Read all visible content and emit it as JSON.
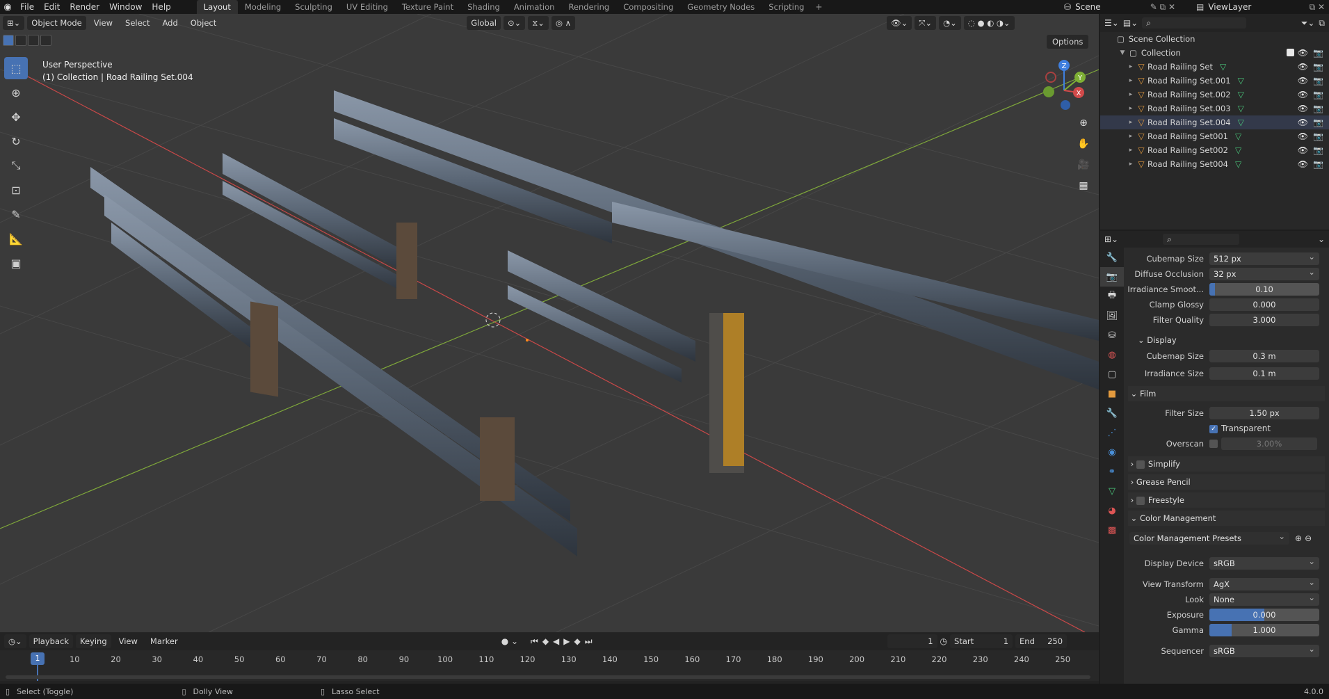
{
  "topbar": {
    "menus": [
      "File",
      "Edit",
      "Render",
      "Window",
      "Help"
    ],
    "workspaces": [
      {
        "label": "Layout",
        "active": true
      },
      {
        "label": "Modeling"
      },
      {
        "label": "Sculpting"
      },
      {
        "label": "UV Editing"
      },
      {
        "label": "Texture Paint"
      },
      {
        "label": "Shading"
      },
      {
        "label": "Animation"
      },
      {
        "label": "Rendering"
      },
      {
        "label": "Compositing"
      },
      {
        "label": "Geometry Nodes"
      },
      {
        "label": "Scripting"
      }
    ],
    "plus": "+",
    "scene": "Scene",
    "view_layer": "ViewLayer"
  },
  "viewport": {
    "mode": "Object Mode",
    "menus": [
      "View",
      "Select",
      "Add",
      "Object"
    ],
    "orientation": "Global",
    "options": "Options",
    "perspective": "User Perspective",
    "active_info": "(1) Collection | Road Railing Set.004",
    "gizmo_axes": {
      "z": "Z",
      "y": "Y",
      "x": "X"
    }
  },
  "outliner": {
    "scene_collection": "Scene Collection",
    "collection": "Collection",
    "objects": [
      "Road Railing Set",
      "Road Railing Set.001",
      "Road Railing Set.002",
      "Road Railing Set.003",
      "Road Railing Set.004",
      "Road Railing Set001",
      "Road Railing Set002",
      "Road Railing Set004"
    ],
    "selected_index": 4
  },
  "properties": {
    "cubemap_size": {
      "label": "Cubemap Size",
      "value": "512 px"
    },
    "diffuse_occlusion": {
      "label": "Diffuse Occlusion",
      "value": "32 px"
    },
    "irradiance_smooth": {
      "label": "Irradiance Smoot...",
      "value": "0.10",
      "fill": 0.05
    },
    "clamp_glossy": {
      "label": "Clamp Glossy",
      "value": "0.000"
    },
    "filter_quality": {
      "label": "Filter Quality",
      "value": "3.000"
    },
    "display_section": "Display",
    "display_cubemap": {
      "label": "Cubemap Size",
      "value": "0.3 m"
    },
    "irradiance_size": {
      "label": "Irradiance Size",
      "value": "0.1 m"
    },
    "film_section": "Film",
    "filter_size": {
      "label": "Filter Size",
      "value": "1.50 px"
    },
    "transparent": "Transparent",
    "overscan": {
      "label": "Overscan",
      "value": "3.00%"
    },
    "simplify": "Simplify",
    "grease_pencil": "Grease Pencil",
    "freestyle": "Freestyle",
    "color_management": "Color Management",
    "cm_presets": "Color Management Presets",
    "display_device": {
      "label": "Display Device",
      "value": "sRGB"
    },
    "view_transform": {
      "label": "View Transform",
      "value": "AgX"
    },
    "look": {
      "label": "Look",
      "value": "None"
    },
    "exposure": {
      "label": "Exposure",
      "value": "0.000",
      "fill": 0.5
    },
    "gamma": {
      "label": "Gamma",
      "value": "1.000",
      "fill": 0.2
    },
    "sequencer": {
      "label": "Sequencer",
      "value": "sRGB"
    }
  },
  "timeline": {
    "menus": [
      "Playback",
      "Keying",
      "View",
      "Marker"
    ],
    "current_frame": "1",
    "start_label": "Start",
    "start": "1",
    "end_label": "End",
    "end": "250",
    "playhead": "1",
    "ticks": [
      "10",
      "20",
      "30",
      "40",
      "50",
      "60",
      "70",
      "80",
      "90",
      "100",
      "110",
      "120",
      "130",
      "140",
      "150",
      "160",
      "170",
      "180",
      "190",
      "200",
      "210",
      "220",
      "230",
      "240",
      "250"
    ]
  },
  "status": {
    "select": "Select (Toggle)",
    "dolly": "Dolly View",
    "lasso": "Lasso Select",
    "version": "4.0.0"
  },
  "colors": {
    "accent": "#4772b3",
    "object_orange": "#e39a3e",
    "mesh_green": "#49c47a",
    "x_axis": "#d24a4a",
    "y_axis": "#7fb035",
    "z_axis": "#3f7fde"
  }
}
